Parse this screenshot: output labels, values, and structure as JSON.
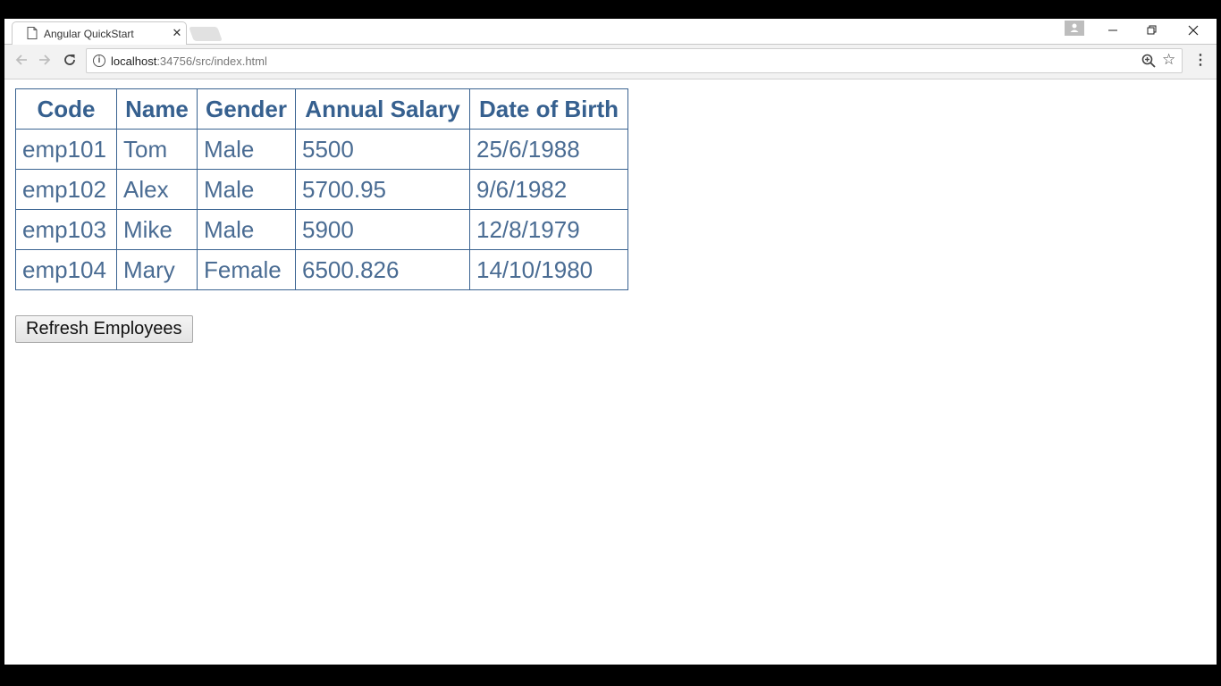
{
  "browser": {
    "tab_title": "Angular QuickStart",
    "tab_close": "✕",
    "url_host": "localhost",
    "url_rest": ":34756/src/index.html",
    "icons": {
      "back": "arrow-left-icon",
      "forward": "arrow-right-icon",
      "reload": "reload-icon",
      "info": "info-icon",
      "zoom": "zoom-icon",
      "bookmark": "star-icon",
      "menu": "menu-icon",
      "profile": "profile-icon"
    }
  },
  "table": {
    "headers": [
      "Code",
      "Name",
      "Gender",
      "Annual Salary",
      "Date of Birth"
    ],
    "rows": [
      [
        "emp101",
        "Tom",
        "Male",
        "5500",
        "25/6/1988"
      ],
      [
        "emp102",
        "Alex",
        "Male",
        "5700.95",
        "9/6/1982"
      ],
      [
        "emp103",
        "Mike",
        "Male",
        "5900",
        "12/8/1979"
      ],
      [
        "emp104",
        "Mary",
        "Female",
        "6500.826",
        "14/10/1980"
      ]
    ]
  },
  "actions": {
    "refresh_label": "Refresh Employees"
  },
  "colors": {
    "table_text": "#3a6391",
    "table_border": "#3a6391"
  }
}
